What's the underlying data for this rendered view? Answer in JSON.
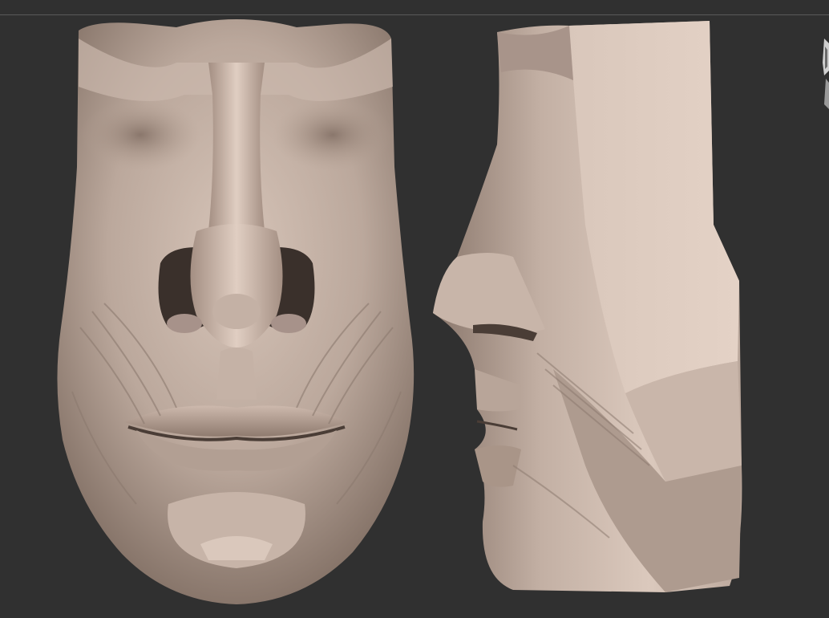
{
  "scene": {
    "viewport_bg": "#303030",
    "border_line_color": "#5a5a5a",
    "clay_color": "#b6a397",
    "clay_highlight": "#d8c6ba",
    "clay_shadow": "#6e5d53"
  },
  "models": [
    {
      "view": "front"
    },
    {
      "view": "side"
    }
  ],
  "widgets": {
    "right_edge": {
      "icon": "gizmo-icon"
    }
  }
}
